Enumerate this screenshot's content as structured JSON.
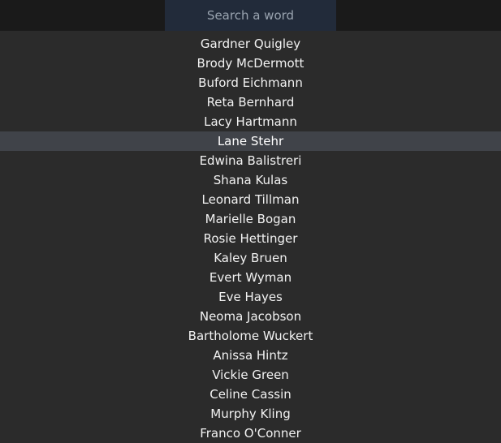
{
  "search": {
    "placeholder": "Search a word",
    "value": "",
    "background_color": "#222b3a",
    "placeholder_color": "#9aa4b0"
  },
  "strip": {
    "background_color": "#1a1a1a"
  },
  "list": {
    "background_color": "#2b2b2b",
    "text_color": "#f2f2f2",
    "selected_background_color": "#404349",
    "selected_index": 5,
    "items": [
      {
        "label": "Gardner Quigley",
        "selected": false
      },
      {
        "label": "Brody McDermott",
        "selected": false
      },
      {
        "label": "Buford Eichmann",
        "selected": false
      },
      {
        "label": "Reta Bernhard",
        "selected": false
      },
      {
        "label": "Lacy Hartmann",
        "selected": false
      },
      {
        "label": "Lane Stehr",
        "selected": true
      },
      {
        "label": "Edwina Balistreri",
        "selected": false
      },
      {
        "label": "Shana Kulas",
        "selected": false
      },
      {
        "label": "Leonard Tillman",
        "selected": false
      },
      {
        "label": "Marielle Bogan",
        "selected": false
      },
      {
        "label": "Rosie Hettinger",
        "selected": false
      },
      {
        "label": "Kaley Bruen",
        "selected": false
      },
      {
        "label": "Evert Wyman",
        "selected": false
      },
      {
        "label": "Eve Hayes",
        "selected": false
      },
      {
        "label": "Neoma Jacobson",
        "selected": false
      },
      {
        "label": "Bartholome Wuckert",
        "selected": false
      },
      {
        "label": "Anissa Hintz",
        "selected": false
      },
      {
        "label": "Vickie Green",
        "selected": false
      },
      {
        "label": "Celine Cassin",
        "selected": false
      },
      {
        "label": "Murphy Kling",
        "selected": false
      },
      {
        "label": "Franco O'Conner",
        "selected": false
      }
    ]
  }
}
